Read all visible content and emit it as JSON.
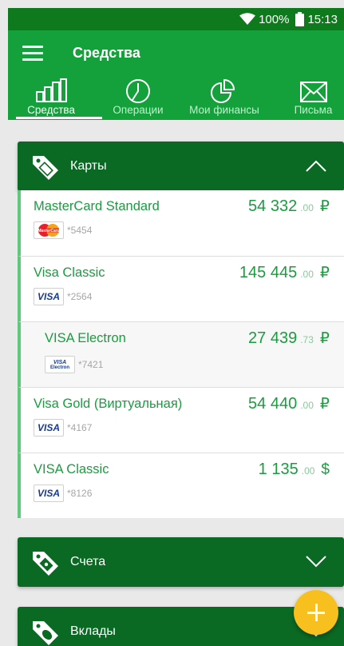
{
  "status_bar": {
    "battery": "100%",
    "time": "15:13"
  },
  "header": {
    "title": "Средства"
  },
  "tabs": [
    {
      "label": "Средства",
      "icon": "bar-chart-icon"
    },
    {
      "label": "Операции",
      "icon": "clock-icon"
    },
    {
      "label": "Мои финансы",
      "icon": "pie-chart-icon"
    },
    {
      "label": "Письма",
      "icon": "envelope-icon"
    }
  ],
  "sections": [
    {
      "title": "Карты",
      "expanded": true
    },
    {
      "title": "Счета",
      "expanded": false
    },
    {
      "title": "Вклады",
      "expanded": false
    }
  ],
  "cards": [
    {
      "name": "MasterCard Standard",
      "amount_int": "54 332",
      "amount_dec": ".00",
      "currency": "₽",
      "brand": "MasterCard",
      "masked_number": "*5454"
    },
    {
      "name": "Visa Classic",
      "amount_int": "145 445",
      "amount_dec": ".00",
      "currency": "₽",
      "brand": "VISA",
      "masked_number": "*2564"
    },
    {
      "name": "VISA Electron",
      "amount_int": "27 439",
      "amount_dec": ".73",
      "currency": "₽",
      "brand": "VISA Electron",
      "brand_top": "VISA",
      "brand_bottom": "Electron",
      "masked_number": "*7421"
    },
    {
      "name": "Visa Gold (Виртуальная)",
      "amount_int": "54 440",
      "amount_dec": ".00",
      "currency": "₽",
      "brand": "VISA",
      "masked_number": "*4167"
    },
    {
      "name": "VISA Classic",
      "amount_int": "1 135",
      "amount_dec": ".00",
      "currency": "$",
      "brand": "VISA",
      "masked_number": "*8126"
    }
  ],
  "colors": {
    "primary": "#14a03a",
    "status_bar": "#0f7a1d",
    "section_header": "#0a6a24",
    "accent_text": "#1a9c3f",
    "fab": "#f7c01f"
  }
}
